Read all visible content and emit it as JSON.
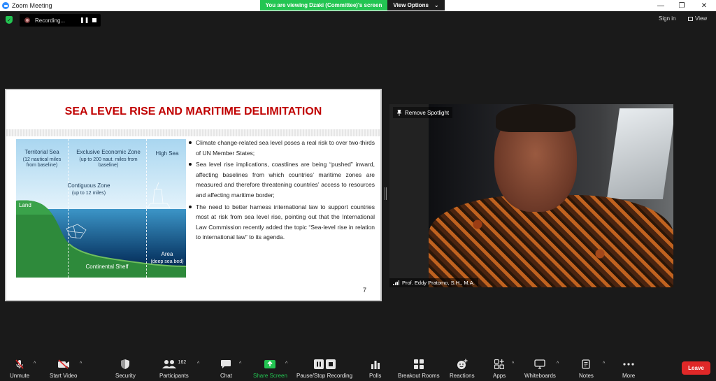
{
  "window": {
    "title": "Zoom Meeting",
    "minimize": "—",
    "restore": "❐",
    "close": "✕"
  },
  "banner": {
    "viewing_text": "You are viewing Dzaki (Committee)'s screen",
    "view_options": "View Options",
    "view_options_caret": "⌄"
  },
  "recording": {
    "label": "Recording...",
    "pause_glyph": "❚❚"
  },
  "topright": {
    "signin": "Sign in",
    "view": "View"
  },
  "slide": {
    "title": "SEA LEVEL RISE AND MARITIME DELIMITATION",
    "number": "7",
    "image_labels": {
      "territorial_sea": "Territorial Sea",
      "territorial_sub": "(12 nautical miles from baseline)",
      "eez": "Exclusive Economic Zone",
      "eez_sub": "(up to 200 naut. miles from baseline)",
      "high_sea": "High Sea",
      "contiguous": "Contiguous Zone",
      "contiguous_sub": "(up to 12 miles)",
      "land": "Land",
      "area": "Area",
      "area_sub": "(deep sea bed)",
      "shelf": "Continental Shelf"
    },
    "bullets": [
      "Climate change-related sea level poses a real risk to over two-thirds of UN Member States;",
      "Sea level rise implications, coastlines are being “pushed” inward, affecting baselines from which countries’ maritime zones are measured and therefore threatening countries’ access to resources and affecting maritime border;",
      "The need to better harness international law to support countries most at risk from sea level rise, pointing out that the International Law Commission recently added the topic “Sea-level rise in relation to international law” to its agenda."
    ]
  },
  "video": {
    "spotlight_label": "Remove Spotlight",
    "participant_name": "Prof. Eddy Pratomo, S.H., M.A."
  },
  "toolbar": {
    "unmute": "Unmute",
    "start_video": "Start Video",
    "security": "Security",
    "participants": "Participants",
    "participants_count": "162",
    "chat": "Chat",
    "share_screen": "Share Screen",
    "pause_stop_recording": "Pause/Stop Recording",
    "polls": "Polls",
    "breakout_rooms": "Breakout Rooms",
    "reactions": "Reactions",
    "apps": "Apps",
    "whiteboards": "Whiteboards",
    "notes": "Notes",
    "more": "More",
    "leave": "Leave",
    "caret": "^"
  },
  "colors": {
    "share_green": "#23c552",
    "leave_red": "#e02828",
    "slide_title_red": "#c00000",
    "zoom_blue": "#2d8cff"
  }
}
